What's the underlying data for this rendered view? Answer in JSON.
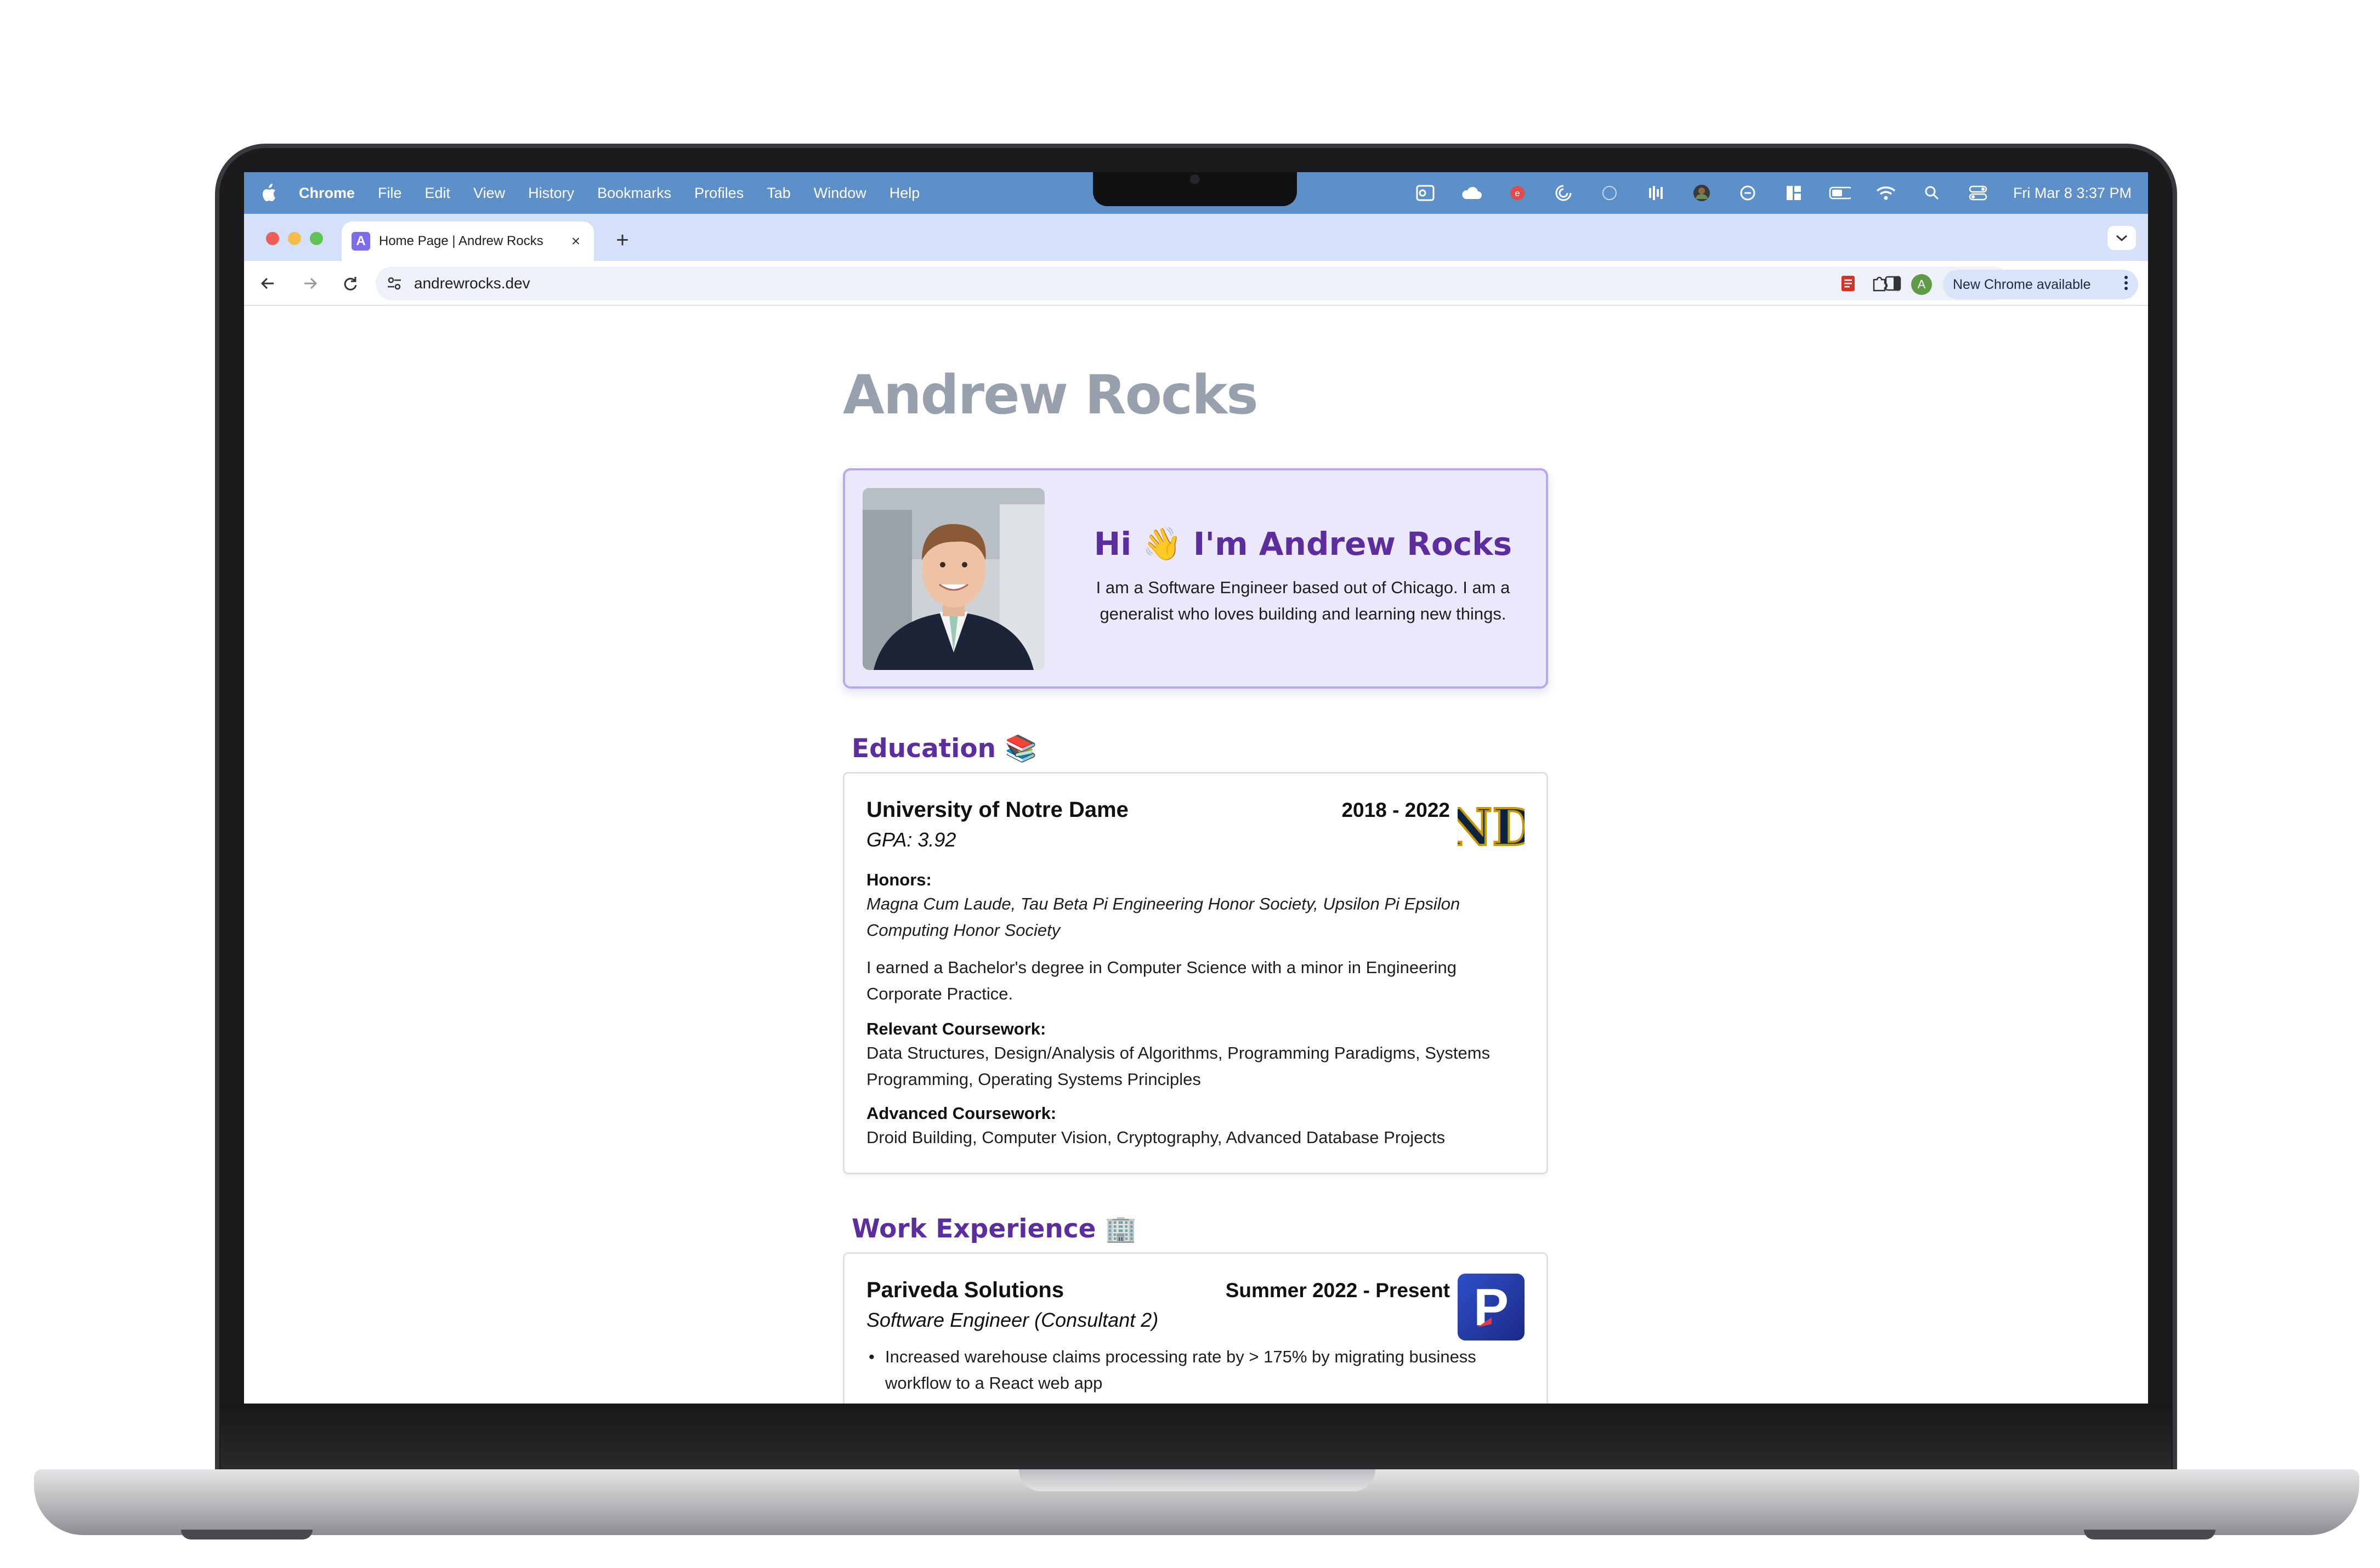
{
  "menubar": {
    "app": "Chrome",
    "items": [
      "File",
      "Edit",
      "View",
      "History",
      "Bookmarks",
      "Profiles",
      "Tab",
      "Window",
      "Help"
    ],
    "clock": "Fri Mar 8  3:37 PM"
  },
  "tab": {
    "favicon": "A",
    "title": "Home Page | Andrew Rocks",
    "close": "×",
    "new_tab": "+"
  },
  "toolbar": {
    "url": "andrewrocks.dev",
    "profile_initial": "A",
    "update_label": "New Chrome available"
  },
  "page": {
    "title": "Andrew Rocks",
    "hero": {
      "greeting": "Hi 👋 I'm Andrew Rocks",
      "bio": "I am a Software Engineer based out of Chicago. I am a generalist who loves building and learning new things."
    },
    "education": {
      "heading": "Education 📚",
      "school": "University of Notre Dame",
      "gpa": "GPA: 3.92",
      "dates": "2018 - 2022",
      "honors_label": "Honors:",
      "honors": "Magna Cum Laude, Tau Beta Pi Engineering Honor Society, Upsilon Pi Epsilon Computing Honor Society",
      "degree": "I earned a Bachelor's degree in Computer Science with a minor in Engineering Corporate Practice.",
      "relevant_label": "Relevant Coursework:",
      "relevant": "Data Structures, Design/Analysis of Algorithms, Programming Paradigms, Systems Programming, Operating Systems Principles",
      "advanced_label": "Advanced Coursework:",
      "advanced": "Droid Building, Computer Vision, Cryptography, Advanced Database Projects",
      "logo_text": "ND"
    },
    "work": {
      "heading": "Work Experience 🏢",
      "company": "Pariveda Solutions",
      "role": "Software Engineer (Consultant 2)",
      "dates": "Summer 2022 - Present",
      "bullets": [
        "Increased warehouse claims processing rate by > 175% by migrating business workflow to a React web app"
      ],
      "logo_text": "P"
    }
  },
  "colors": {
    "menubar_bg": "#5d8fc8",
    "tabstrip_bg": "#d4e1f8",
    "accent_purple": "#5b2d9e",
    "hero_bg": "#ece8fc",
    "title_gray": "#99a0ad"
  },
  "icons": [
    "apple-icon",
    "outlook-icon",
    "cloud-icon",
    "badge-icon",
    "activity-icon",
    "audio-icon",
    "avatar-icon",
    "focus-icon",
    "layout-icon",
    "battery-icon",
    "wifi-icon",
    "search-icon",
    "control-center-icon",
    "back-icon",
    "forward-icon",
    "reload-icon",
    "site-info-icon",
    "star-icon",
    "extension-icon",
    "sidepanel-icon",
    "kebab-icon"
  ]
}
